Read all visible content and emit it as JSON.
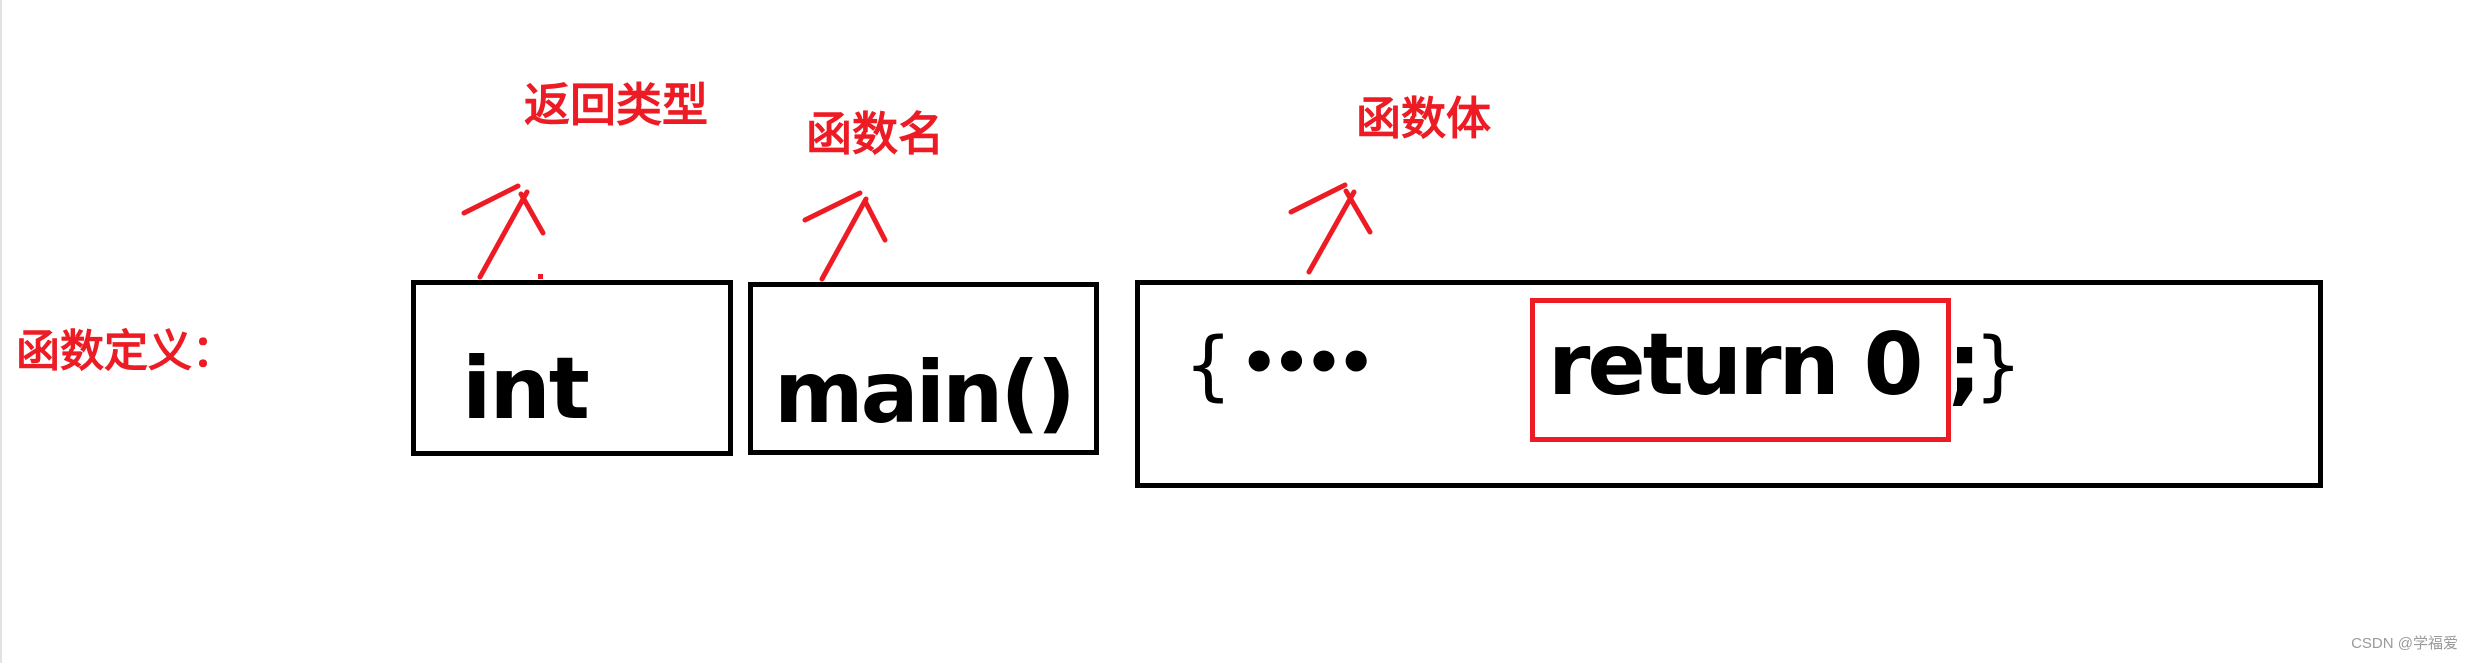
{
  "diagram": {
    "title_label": "函数定义：",
    "annotations": {
      "return_type": "返回类型",
      "function_name": "函数名",
      "function_body": "函数体"
    },
    "code": {
      "return_type": "int",
      "function_name": "main()",
      "body_open": "{",
      "body_ellipsis": "••••",
      "return_statement": "return 0 ;",
      "body_close": "}"
    },
    "colors": {
      "annotation_red": "#ed1c24",
      "box_black": "#000000",
      "highlight_red": "#ed1c24"
    }
  },
  "watermark": "CSDN @学福爱"
}
